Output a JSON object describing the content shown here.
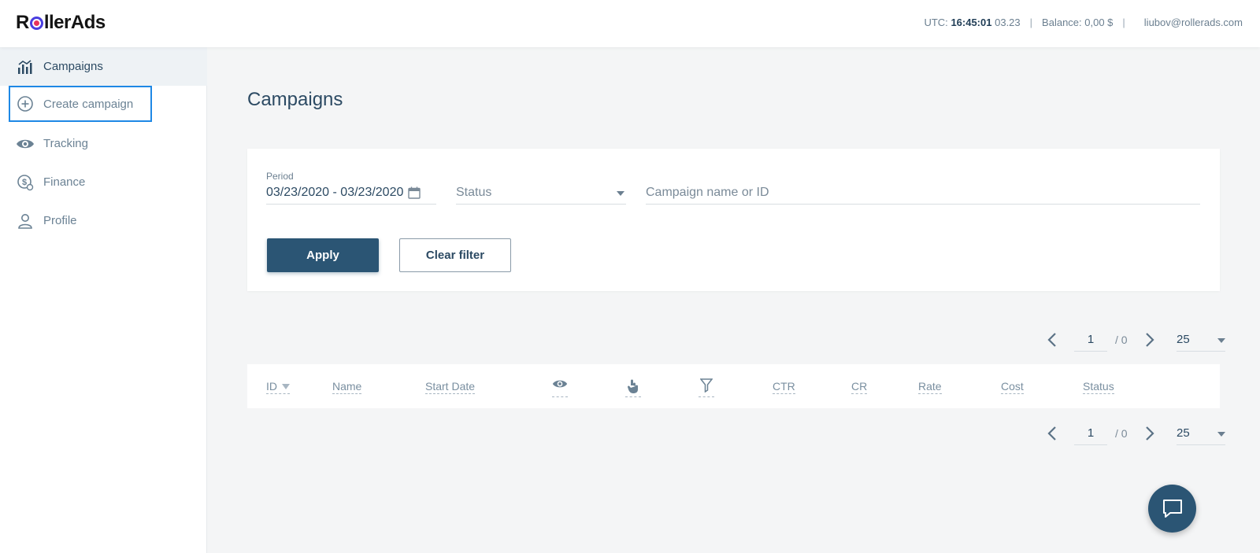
{
  "header": {
    "logo_text_pre": "R",
    "logo_text_post": "llerAds",
    "utc_label": "UTC:",
    "utc_time": "16:45:01",
    "utc_date": "03.23",
    "balance": "Balance: 0,00 $",
    "user_email": "liubov@rollerads.com"
  },
  "sidebar": {
    "items": [
      {
        "label": "Campaigns",
        "icon": "bar-chart-icon"
      },
      {
        "label": "Create campaign",
        "icon": "plus-circle-icon"
      },
      {
        "label": "Tracking",
        "icon": "eye-icon"
      },
      {
        "label": "Finance",
        "icon": "coin-icon"
      },
      {
        "label": "Profile",
        "icon": "user-icon"
      }
    ]
  },
  "main": {
    "title": "Campaigns",
    "filter": {
      "period_label": "Period",
      "period_value": "03/23/2020 - 03/23/2020",
      "status_placeholder": "Status",
      "search_placeholder": "Campaign name or ID",
      "apply_label": "Apply",
      "clear_label": "Clear filter"
    },
    "pagination": {
      "current_page": "1",
      "total_pages": "/ 0",
      "per_page": "25"
    },
    "table": {
      "columns": [
        "ID",
        "Name",
        "Start Date",
        "CTR",
        "CR",
        "Rate",
        "Cost",
        "Status"
      ],
      "icon_columns": [
        "eye-icon",
        "click-hand-icon",
        "filter-icon"
      ]
    }
  },
  "colors": {
    "primary": "#2b5574",
    "focus": "#1e88e5",
    "text": "#2c4a63"
  }
}
